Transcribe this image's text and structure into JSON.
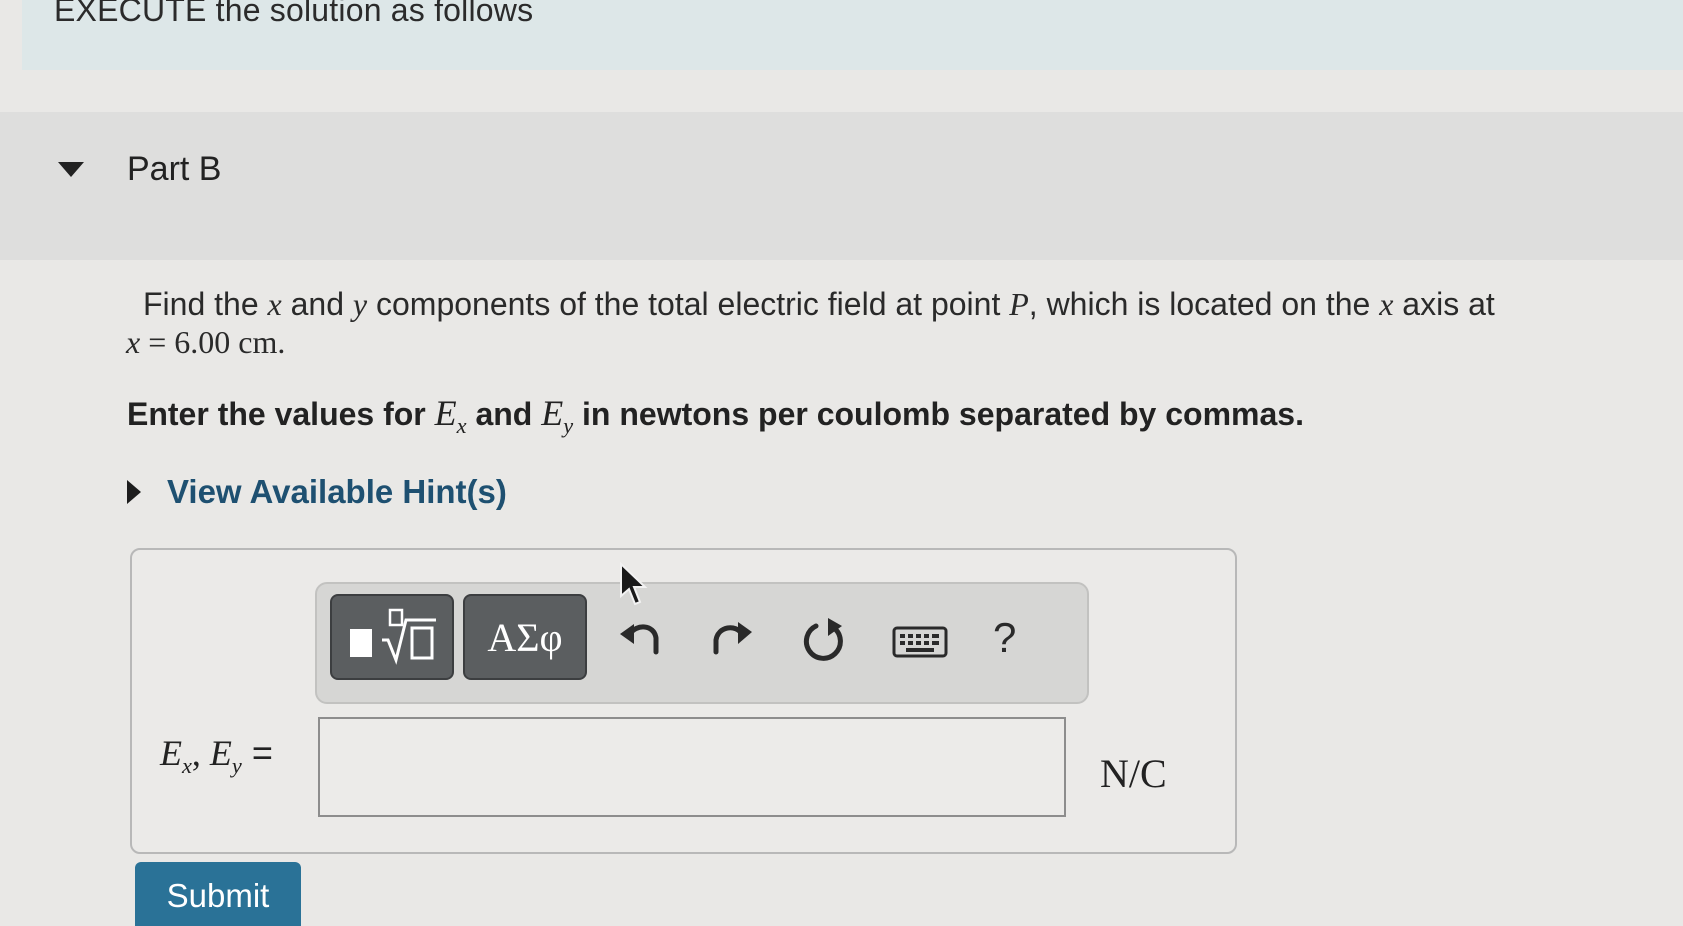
{
  "banner": {
    "title": "EXECUTE the solution as follows"
  },
  "part": {
    "title": "Part B"
  },
  "question": {
    "t1": "Find the ",
    "v_x": "x",
    "t2": " and ",
    "v_y": "y",
    "t3": " components of the total electric field at point ",
    "v_P": "P",
    "t4": ", which is located on the ",
    "v_x2": "x",
    "t5": " axis at",
    "eq_var": "x",
    "eq_rest": " = 6.00 cm."
  },
  "instruction": {
    "t1": "Enter the values for ",
    "e1": "E",
    "e1_sub": "x",
    "t2": " and ",
    "e2": "E",
    "e2_sub": "y",
    "t3": " in newtons per coulomb separated by commas."
  },
  "hints": {
    "label": "View Available Hint(s)"
  },
  "toolbar": {
    "symbols_label": "ΑΣφ",
    "help_label": "?",
    "icons": [
      "templates-icon",
      "undo-icon",
      "redo-icon",
      "reset-icon",
      "keyboard-icon"
    ]
  },
  "answer": {
    "label_e1": "E",
    "label_sub1": "x",
    "label_sep": ", ",
    "label_e2": "E",
    "label_sub2": "y",
    "label_eq": " =",
    "value": "",
    "unit": "N/C"
  },
  "submit": {
    "label": "Submit"
  },
  "colors": {
    "background": "#e9e8e6",
    "banner": "#dde7e8",
    "hint_link": "#1e5071",
    "submit": "#2a7297",
    "toolbar_button": "#5b5e60"
  }
}
